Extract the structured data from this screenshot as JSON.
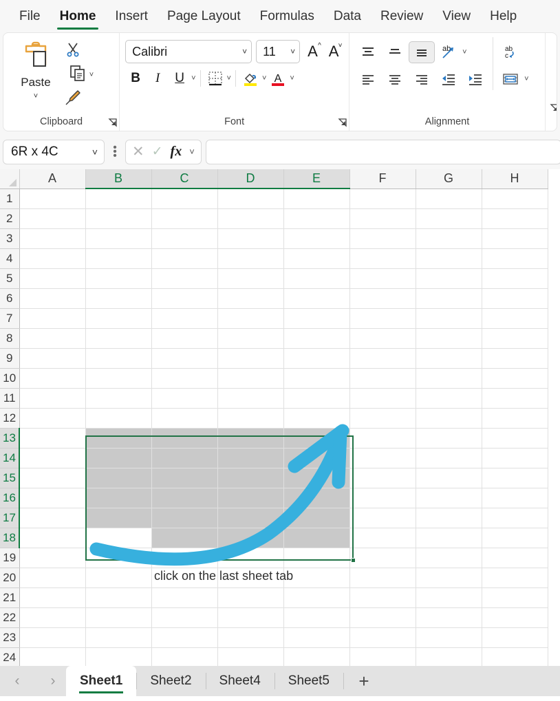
{
  "ribbon": {
    "tabs": [
      {
        "label": "File",
        "active": false
      },
      {
        "label": "Home",
        "active": true
      },
      {
        "label": "Insert",
        "active": false
      },
      {
        "label": "Page Layout",
        "active": false
      },
      {
        "label": "Formulas",
        "active": false
      },
      {
        "label": "Data",
        "active": false
      },
      {
        "label": "Review",
        "active": false
      },
      {
        "label": "View",
        "active": false
      },
      {
        "label": "Help",
        "active": false
      }
    ],
    "groups": {
      "clipboard": {
        "label": "Clipboard",
        "paste_label": "Paste",
        "icons": [
          "paste-icon",
          "cut-icon",
          "copy-icon",
          "format-painter-icon"
        ]
      },
      "font": {
        "label": "Font",
        "font_name": "Calibri",
        "font_size": "11",
        "bold": "B",
        "italic": "I",
        "underline": "U",
        "grow_font": "A",
        "shrink_font": "A",
        "icons": [
          "borders-icon",
          "fill-color-icon",
          "font-color-icon"
        ]
      },
      "alignment": {
        "label": "Alignment",
        "icons": [
          "align-top-icon",
          "align-middle-icon",
          "align-bottom-icon",
          "orientation-icon",
          "wrap-text-icon",
          "align-left-icon",
          "align-center-icon",
          "align-right-icon",
          "decrease-indent-icon",
          "increase-indent-icon",
          "merge-center-icon"
        ]
      }
    }
  },
  "formula_bar": {
    "name_box_value": "6R x 4C",
    "cancel_icon": "cancel-icon",
    "enter_icon": "enter-icon",
    "fx_label": "fx",
    "formula_value": "",
    "formula_placeholder": ""
  },
  "grid": {
    "columns": [
      "A",
      "B",
      "C",
      "D",
      "E",
      "F",
      "G",
      "H"
    ],
    "highlighted_columns": [
      "B",
      "C",
      "D",
      "E"
    ],
    "rows": [
      1,
      2,
      3,
      4,
      5,
      6,
      7,
      8,
      9,
      10,
      11,
      12,
      13,
      14,
      15,
      16,
      17,
      18,
      19,
      20,
      21,
      22,
      23,
      24
    ],
    "highlighted_rows": [
      13,
      14,
      15,
      16,
      17,
      18
    ],
    "selection_range": "B13:E18",
    "active_cell": "B18"
  },
  "annotation": {
    "text": "click on the last sheet tab",
    "arrow_color": "#37B0DE",
    "arrow_icon": "curved-arrow-icon"
  },
  "sheet_tabs": {
    "prev_icon": "chevron-left-icon",
    "next_icon": "chevron-right-icon",
    "add_icon": "plus-icon",
    "tabs": [
      {
        "label": "Sheet1",
        "active": true
      },
      {
        "label": "Sheet2",
        "active": false
      },
      {
        "label": "Sheet4",
        "active": false
      },
      {
        "label": "Sheet5",
        "active": false
      }
    ]
  },
  "colors": {
    "accent_green": "#107c41",
    "selection_border": "#217346",
    "selection_fill": "#c9c9c9",
    "arrow_blue": "#37B0DE"
  }
}
